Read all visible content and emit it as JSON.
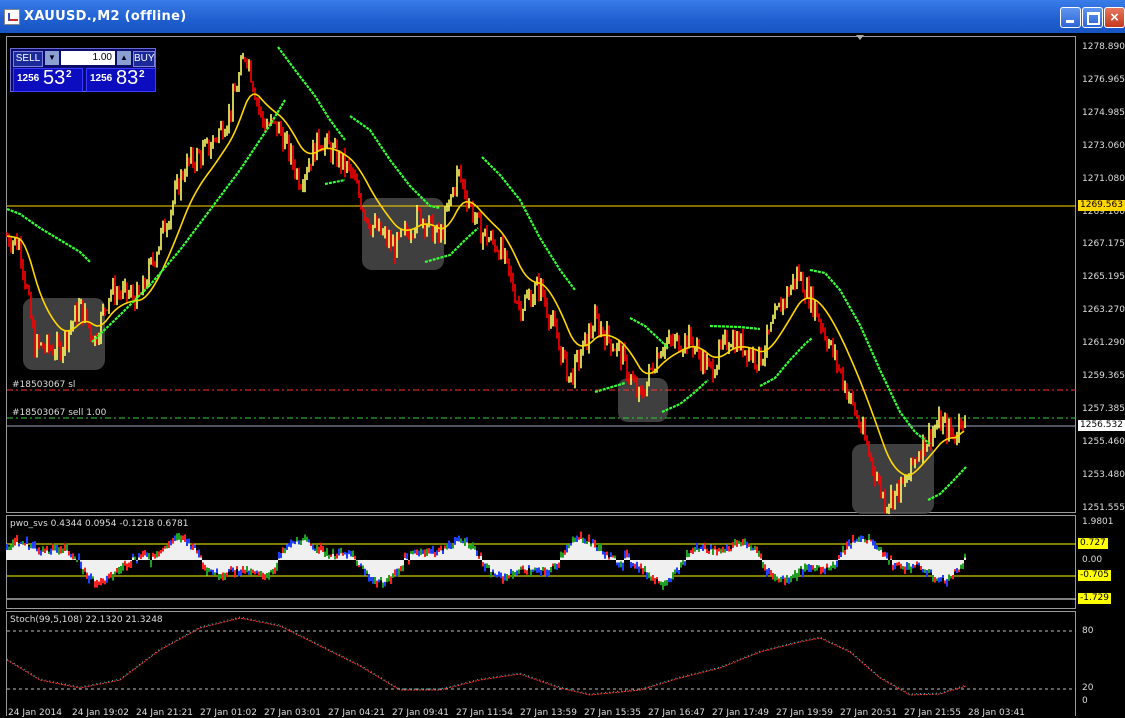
{
  "window": {
    "title": "XAUUSD.,M2 (offline)",
    "close_glyph": "×"
  },
  "trade_panel": {
    "sell_label": "SELL",
    "buy_label": "BUY",
    "lot": "1.00",
    "down_glyph": "▼",
    "up_glyph": "▲",
    "bid_prefix": "1256",
    "bid_main": "53",
    "bid_sup": "2",
    "ask_prefix": "1256",
    "ask_main": "83",
    "ask_sup": "2"
  },
  "order_lines": {
    "sl_label": "#18503067 sl",
    "entry_label": "#18503067 sell 1.00"
  },
  "price_axis": {
    "ticks": [
      "1278.890",
      "1276.965",
      "1274.985",
      "1273.060",
      "1271.080",
      "1269.100",
      "1267.175",
      "1265.195",
      "1263.270",
      "1261.290",
      "1259.365",
      "1257.385",
      "1255.460",
      "1253.480",
      "1251.555"
    ],
    "h_line_price": "1269.563",
    "current_price": "1256.532"
  },
  "pwo": {
    "label": "pwo_svs 0.4344 0.0954 -0.1218 0.6781",
    "top": "1.9801",
    "zero": "0.00",
    "upper": "0.727",
    "lower": "-0.705",
    "bottom": "-1.729"
  },
  "stoch": {
    "label": "Stoch(99,5,108) 22.1320 21.3248",
    "l80": "80",
    "l20": "20",
    "l0": "0"
  },
  "time_axis": [
    "24 Jan 2014",
    "24 Jan 19:02",
    "24 Jan 21:21",
    "27 Jan 01:02",
    "27 Jan 03:01",
    "27 Jan 04:21",
    "27 Jan 09:41",
    "27 Jan 11:54",
    "27 Jan 13:59",
    "27 Jan 15:35",
    "27 Jan 16:47",
    "27 Jan 17:49",
    "27 Jan 19:59",
    "27 Jan 20:51",
    "27 Jan 21:55",
    "28 Jan 03:41"
  ],
  "colors": {
    "bull": "#ffff66",
    "bear": "#ff0000",
    "ma_fast": "#ffd700",
    "band": "#33ff33",
    "hline": "#ffd700"
  }
}
